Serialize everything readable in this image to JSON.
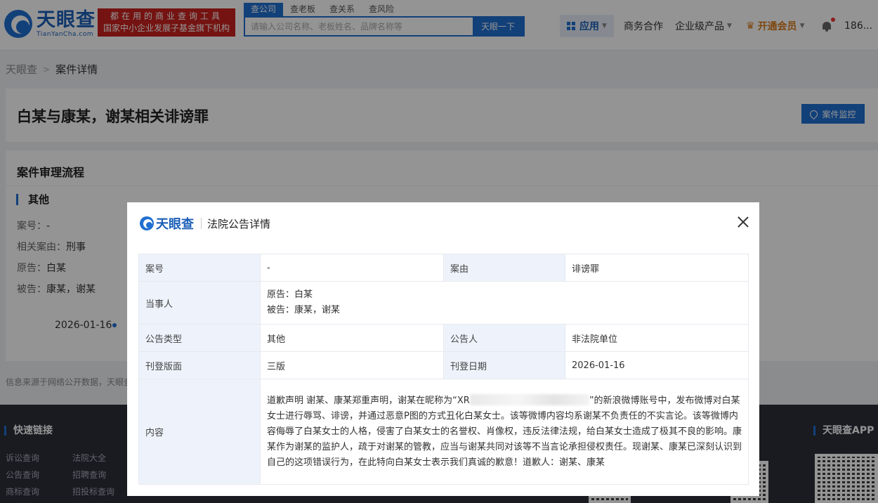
{
  "header": {
    "logo_cn": "天眼查",
    "logo_en": "TianYanCha.com",
    "slogan_line1": "都在用的商业查询工具",
    "slogan_line2": "国家中小企业发展子基金旗下机构",
    "search_tabs": [
      {
        "label": "查公司",
        "active": true
      },
      {
        "label": "查老板",
        "active": false
      },
      {
        "label": "查关系",
        "active": false
      },
      {
        "label": "查风险",
        "active": false
      }
    ],
    "search_placeholder": "请输入公司名称、老板姓名、品牌名称等",
    "search_button": "天眼一下",
    "nav_apps": "应用",
    "nav_business": "商务合作",
    "nav_enterprise": "企业级产品",
    "nav_vip": "开通会员",
    "user": "186..."
  },
  "breadcrumb": {
    "home": "天眼查",
    "current": "案件详情"
  },
  "page": {
    "title": "白某与康某，谢某相关诽谤罪",
    "monitor_button": "案件监控",
    "flow_title": "案件审理流程",
    "section_title": "其他",
    "info": [
      {
        "label": "案号：",
        "value": "-"
      },
      {
        "label": "相关案由：",
        "value": "刑事"
      },
      {
        "label": "原告：",
        "value": "白某"
      },
      {
        "label": "被告：",
        "value": "康某，谢某"
      }
    ],
    "timeline_date": "2026-01-16",
    "source_note": "信息来源于网络公开数据，天眼查"
  },
  "footer": {
    "quick_links_title": "快速链接",
    "links": [
      [
        "诉讼查询",
        "法院大全"
      ],
      [
        "公告查询",
        "招聘查询"
      ],
      [
        "商标查询",
        "招投标查询"
      ]
    ],
    "app_title": "天眼查APP"
  },
  "modal": {
    "logo_text": "天眼查",
    "title": "法院公告详情",
    "rows": {
      "case_no_label": "案号",
      "case_no_value": "-",
      "cause_label": "案由",
      "cause_value": "诽谤罪",
      "parties_label": "当事人",
      "plaintiff": "原告：白某",
      "defendant": "被告：康某，谢某",
      "type_label": "公告类型",
      "type_value": "其他",
      "announcer_label": "公告人",
      "announcer_value": "非法院单位",
      "layout_label": "刊登版面",
      "layout_value": "三版",
      "date_label": "刊登日期",
      "date_value": "2026-01-16",
      "content_label": "内容",
      "content_before": "道歉声明 谢某、康某郑重声明，谢某在昵称为“XR",
      "content_after": "”的新浪微博账号中，发布微博对白某女士进行辱骂、诽谤，并通过恶意P图的方式丑化白某女士。该等微博内容均系谢某不负责任的不实言论。该等微博内容侮辱了白某女士的人格，侵害了白某女士的名誉权、肖像权，违反法律法规，给白某女士造成了极其不良的影响。康某作为谢某的监护人，疏于对谢某的管教，应当与谢某共同对该等不当言论承担侵权责任。现谢某、康某已深刻认识到自己的这项错误行为，在此特向白某女士表示我们真诚的歉意！道歉人：谢某、康某"
    }
  }
}
